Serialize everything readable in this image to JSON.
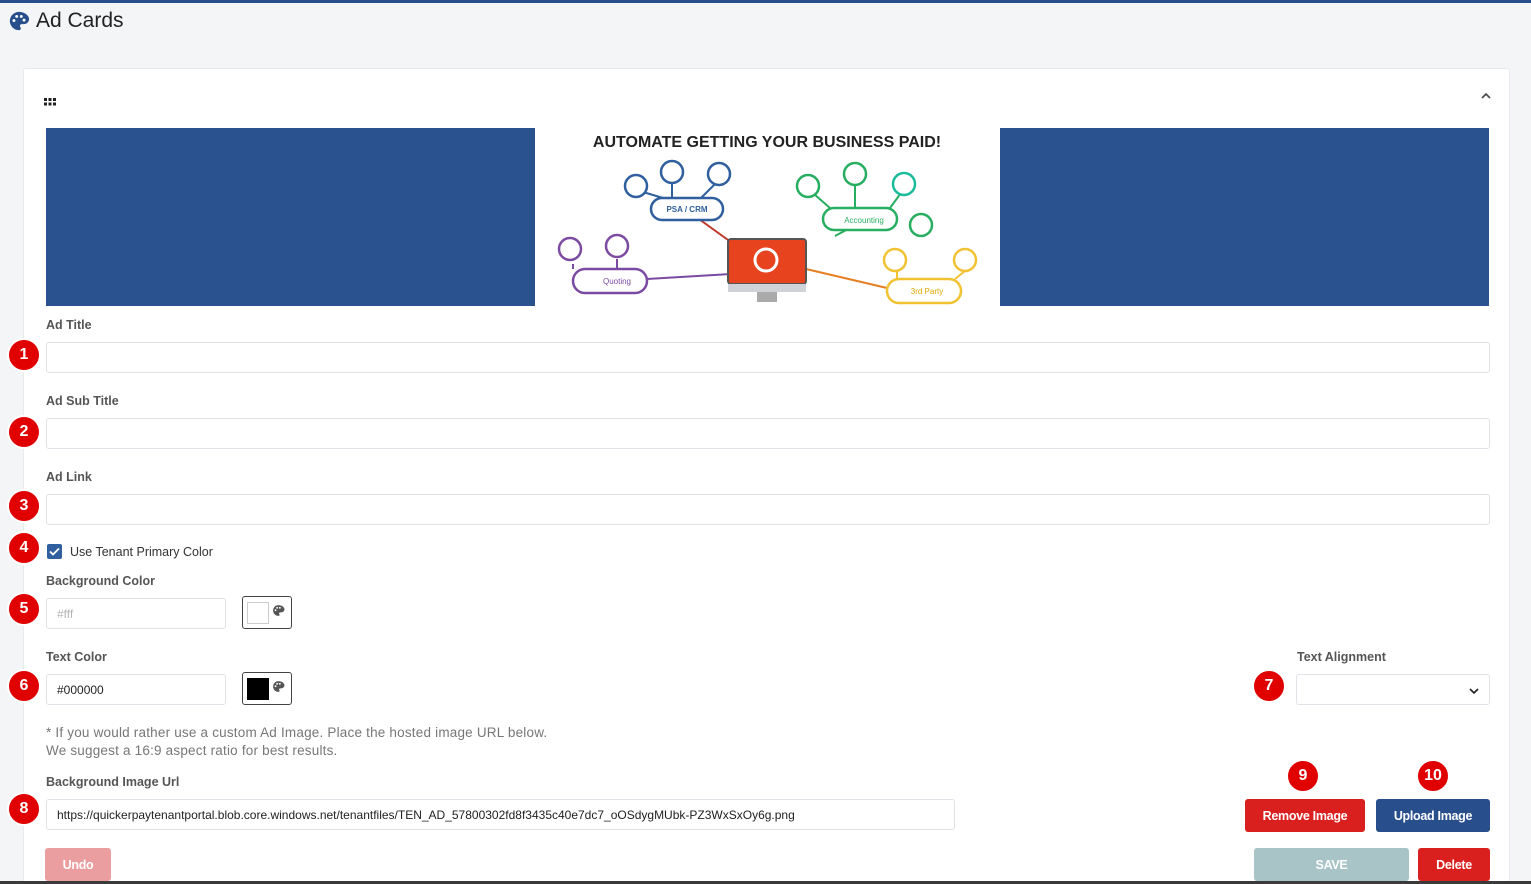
{
  "header": {
    "title": "Ad Cards"
  },
  "banner": {
    "headline": "AUTOMATE GETTING YOUR BUSINESS PAID!",
    "nodes": {
      "psa": "PSA / CRM",
      "accounting": "Accounting",
      "quoting": "Quoting",
      "third_party": "3rd Party"
    }
  },
  "form": {
    "ad_title": {
      "label": "Ad Title",
      "value": ""
    },
    "ad_sub_title": {
      "label": "Ad Sub Title",
      "value": ""
    },
    "ad_link": {
      "label": "Ad Link",
      "value": ""
    },
    "use_tenant_primary_color": {
      "label": "Use Tenant Primary Color",
      "checked": true
    },
    "background_color": {
      "label": "Background Color",
      "placeholder": "#fff",
      "swatch": "#ffffff"
    },
    "text_color": {
      "label": "Text Color",
      "value": "#000000",
      "swatch": "#000000"
    },
    "text_alignment": {
      "label": "Text Alignment",
      "value": ""
    },
    "note_line1": "* If you would rather use a custom Ad Image. Place the hosted image URL below.",
    "note_line2": "We suggest a 16:9 aspect ratio for best results.",
    "background_image_url": {
      "label": "Background Image Url",
      "value": "https://quickerpaytenantportal.blob.core.windows.net/tenantfiles/TEN_AD_57800302fd8f3435c40e7dc7_oOSdygMUbk-PZ3WxSxOy6g.png"
    }
  },
  "buttons": {
    "remove_image": "Remove Image",
    "upload_image": "Upload Image",
    "undo": "Undo",
    "save": "SAVE",
    "delete": "Delete"
  },
  "annotations": [
    "1",
    "2",
    "3",
    "4",
    "5",
    "6",
    "7",
    "8",
    "9",
    "10"
  ],
  "colors": {
    "primary": "#284f8c",
    "danger": "#d9201f",
    "badge": "#e00000",
    "banner_bg": "#2a528f"
  }
}
